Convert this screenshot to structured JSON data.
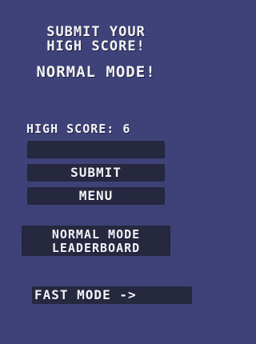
{
  "header": {
    "title_line1": "SUBMIT YOUR",
    "title_line2": "HIGH SCORE!",
    "mode_title": "NORMAL MODE!"
  },
  "score": {
    "label": "HIGH SCORE: 6"
  },
  "name_input": {
    "value": ""
  },
  "buttons": {
    "submit_label": "SUBMIT",
    "menu_label": "MENU",
    "leaderboard_line1": "NORMAL MODE",
    "leaderboard_line2": "LEADERBOARD",
    "fast_mode_label": "FAST MODE ->"
  },
  "colors": {
    "background": "#3f4278",
    "button_bg": "#25283e",
    "text": "#f4f4f4"
  }
}
